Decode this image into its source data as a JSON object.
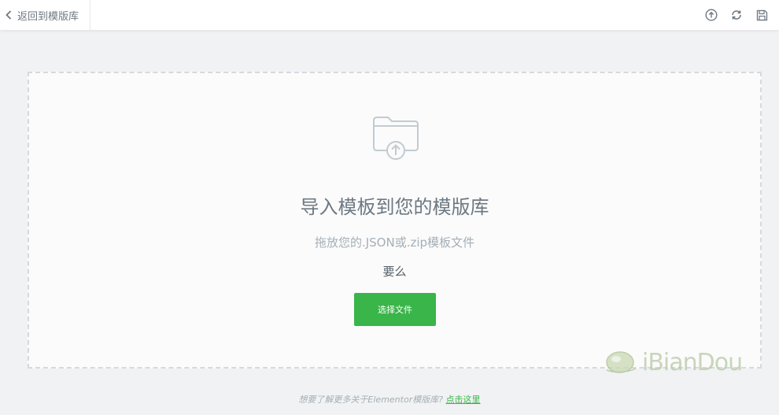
{
  "header": {
    "back_label": "返回到模版库",
    "tools": [
      "upload-icon",
      "sync-icon",
      "save-icon"
    ]
  },
  "import": {
    "title": "导入模板到您的模版库",
    "instruction": "拖放您的.JSON或.zip模板文件",
    "or_text": "要么",
    "button_label": "选择文件"
  },
  "footer": {
    "question": "想要了解更多关于Elementor模版库?",
    "link_label": "点击这里"
  },
  "watermark": {
    "text": "iBianDou"
  },
  "colors": {
    "accent": "#39b54a",
    "background": "#f1f2f3",
    "text": "#6d7882",
    "muted": "#a4afb7"
  }
}
